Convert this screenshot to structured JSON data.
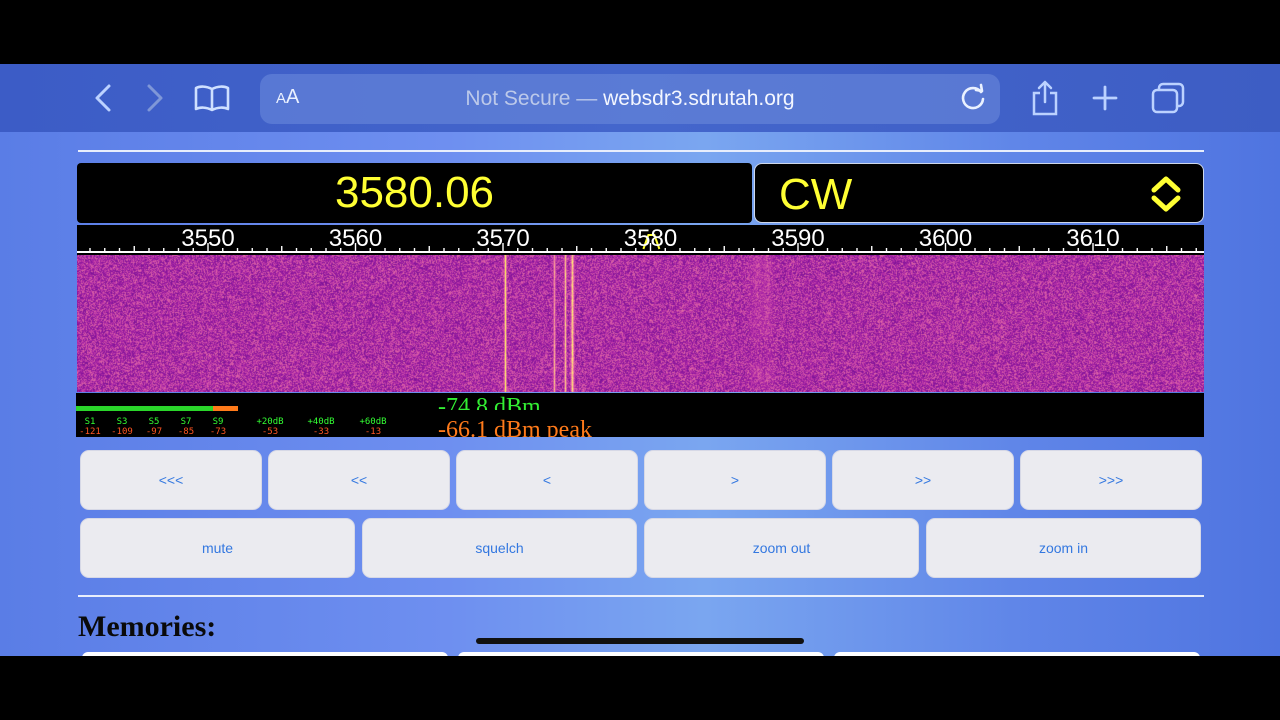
{
  "browser": {
    "aa_label_small": "A",
    "aa_label_large": "A",
    "url_prefix": "Not Secure — ",
    "url_host": "websdr3.sdrutah.org",
    "icons": [
      "back-icon",
      "forward-icon",
      "bookmarks-icon",
      "reload-icon",
      "share-icon",
      "new-tab-icon",
      "tabs-icon"
    ]
  },
  "receiver": {
    "frequency": "3580.06",
    "mode": "CW",
    "scale_labels": [
      "3550",
      "3560",
      "3570",
      "3580",
      "3590",
      "3600",
      "3610"
    ],
    "signal_dbm": "-74.8 dBm",
    "peak_dbm": "-66.1 dBm peak",
    "smeter_top": [
      "S1",
      "S3",
      "S5",
      "S7",
      "S9",
      "+20dB",
      "+40dB",
      "+60dB"
    ],
    "smeter_bottom": [
      "-121",
      "-109",
      "-97",
      "-85",
      "-73",
      "-53",
      "-33",
      "-13"
    ],
    "level_fraction": 0.73
  },
  "colors": {
    "frequency_text": "#ffff33",
    "waterfall_base": "#a020c8",
    "meter_green": "#2ad52a",
    "meter_orange": "#ff7a1a",
    "button_text": "#3478e0"
  },
  "tuning_buttons": [
    "<<<",
    "<<",
    "<",
    ">",
    ">>",
    ">>>"
  ],
  "control_buttons": [
    "mute",
    "squelch",
    "zoom out",
    "zoom in"
  ],
  "memories_heading": "Memories:"
}
